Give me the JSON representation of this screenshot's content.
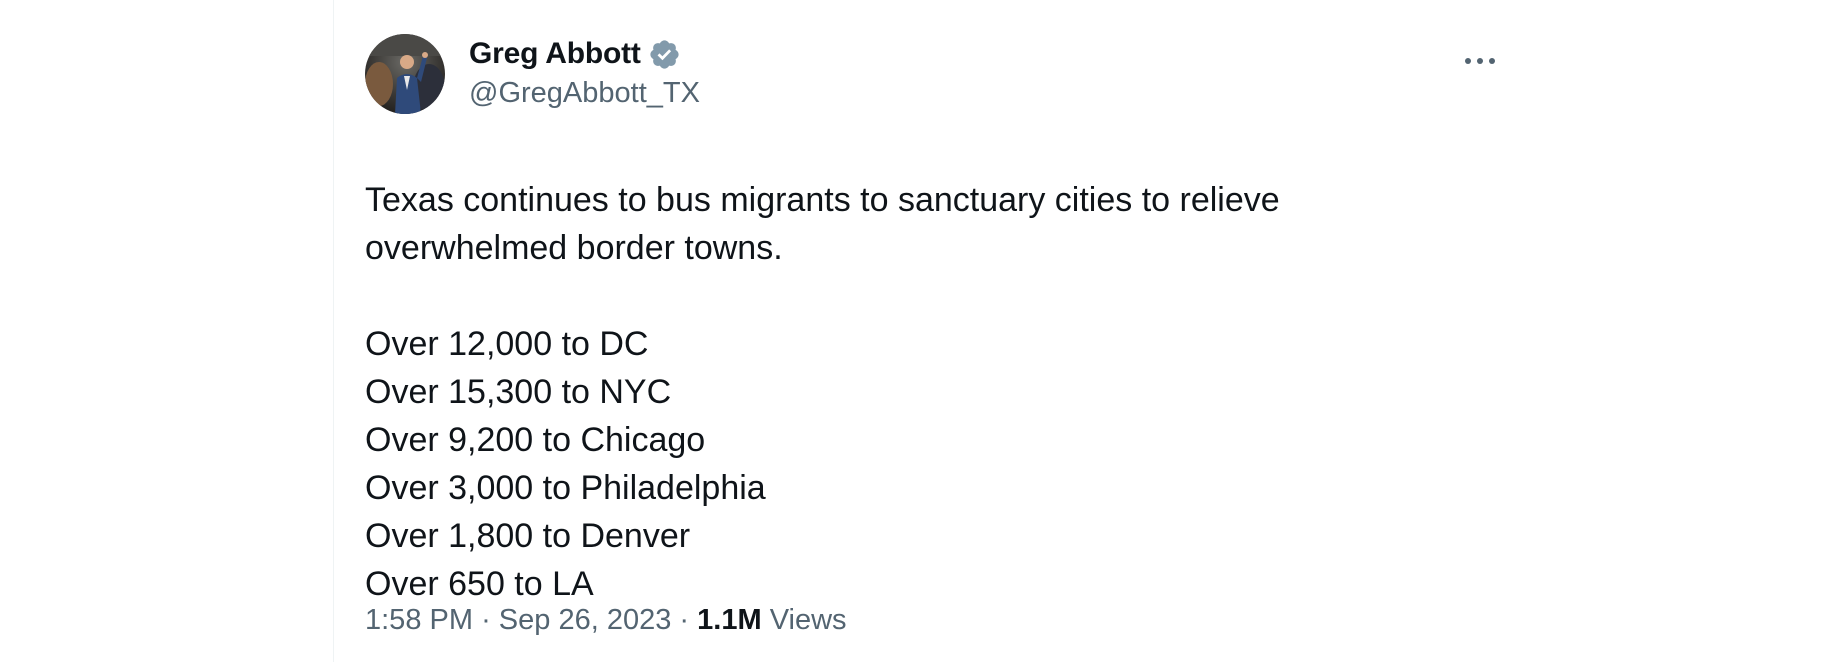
{
  "tweet": {
    "author": {
      "display_name": "Greg Abbott",
      "handle": "@GregAbbott_TX",
      "verified": true,
      "verified_badge_color": "#829aab",
      "avatar_icon": "profile-photo"
    },
    "more_icon": "more-horizontal-icon",
    "text_lines": [
      "Texas continues to bus migrants to sanctuary cities to relieve",
      "overwhelmed border towns.",
      "",
      "Over 12,000 to DC",
      "Over 15,300 to NYC",
      "Over 9,200 to Chicago",
      "Over 3,000 to Philadelphia",
      "Over 1,800 to Denver",
      "Over 650 to LA"
    ],
    "meta": {
      "time": "1:58 PM",
      "separator": "·",
      "date": "Sep 26, 2023",
      "views_count": "1.1M",
      "views_label": "Views"
    }
  },
  "colors": {
    "primary_text": "#0f1419",
    "secondary_text": "#536471",
    "border": "#eff3f4"
  }
}
